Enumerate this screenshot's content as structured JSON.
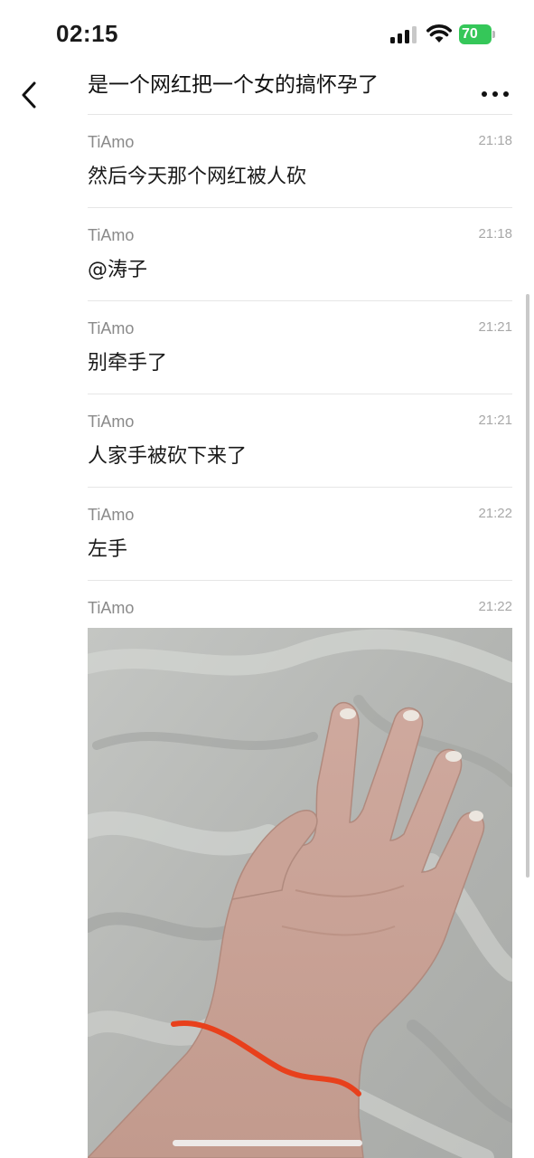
{
  "status_bar": {
    "time": "02:15",
    "battery": "70",
    "icons": [
      "signal-icon",
      "wifi-icon",
      "battery-icon"
    ]
  },
  "header": {
    "title": "是一个网红把一个女的搞怀孕了",
    "back_icon": "chevron-left-icon",
    "more_icon": "more-dots-icon"
  },
  "messages": [
    {
      "sender": "TiAmo",
      "time": "21:18",
      "text": "然后今天那个网红被人砍"
    },
    {
      "sender": "TiAmo",
      "time": "21:18",
      "text": "@涛子"
    },
    {
      "sender": "TiAmo",
      "time": "21:21",
      "text": "别牵手了"
    },
    {
      "sender": "TiAmo",
      "time": "21:21",
      "text": "人家手被砍下来了"
    },
    {
      "sender": "TiAmo",
      "time": "21:22",
      "text": "左手"
    },
    {
      "sender": "TiAmo",
      "time": "21:22",
      "image": "photo-of-hand-on-gray-sheet-with-red-line-on-wrist"
    }
  ],
  "colors": {
    "battery": "#35c759",
    "annotation_line": "#e8401c",
    "sheet": "#b9bbb8"
  }
}
